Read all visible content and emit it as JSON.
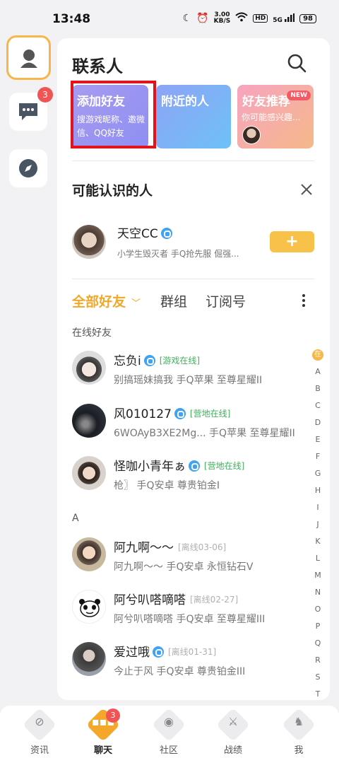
{
  "status_bar": {
    "time": "13:48",
    "net_speed_value": "3.00",
    "net_speed_unit": "KB/S",
    "hd": "HD",
    "signal": "5G",
    "battery": "98"
  },
  "rail": {
    "message_badge": "3"
  },
  "header": {
    "title": "联系人"
  },
  "action_cards": {
    "add_friend_title": "添加好友",
    "add_friend_desc": "搜游戏昵称、邀微信、QQ好友",
    "nearby_title": "附近的人",
    "recommend_title": "好友推荐",
    "recommend_badge": "NEW",
    "recommend_desc": "你可能感兴趣..."
  },
  "suggestions": {
    "title": "可能认识的人",
    "name": "天空CC",
    "desc": "小学生毁灭者 手Q抢先服 倔强...",
    "add_label": "+"
  },
  "tabs": {
    "all_friends": "全部好友",
    "groups": "群组",
    "subscriptions": "订阅号"
  },
  "groups": {
    "online": "在线好友",
    "a": "A"
  },
  "friends": [
    {
      "name": "忘负i",
      "status": "[游戏在线]",
      "desc": "别搞瑶妹搞我  手Q苹果  至尊星耀II"
    },
    {
      "name": "风010127",
      "status": "[营地在线]",
      "desc": "6WOAyB3XE2Mg...  手Q苹果  至尊星耀II"
    },
    {
      "name": "怪咖小青年ぁ",
      "status": "[营地在线]",
      "desc": "枪〗  手Q安卓  尊贵铂金I"
    },
    {
      "name": "阿九啊～～",
      "status": "[离线03-06]",
      "desc": "阿九啊～～  手Q安卓  永恒钻石V"
    },
    {
      "name": "阿兮叭嗒嘀嗒",
      "status": "[离线02-27]",
      "desc": "阿兮叭嗒嘀嗒  手Q安卓  至尊星耀III"
    },
    {
      "name": "爱过哦",
      "status": "[离线01-31]",
      "desc": "今止于风  手Q安卓  尊贵铂金III"
    }
  ],
  "alpha_index": [
    "在",
    "A",
    "B",
    "C",
    "D",
    "E",
    "F",
    "G",
    "H",
    "I",
    "J",
    "K",
    "L",
    "M",
    "N",
    "O",
    "P",
    "Q",
    "R",
    "S",
    "T"
  ],
  "bottom_nav": {
    "news": "资讯",
    "chat": "聊天",
    "community": "社区",
    "record": "战绩",
    "me": "我",
    "chat_badge": "3"
  },
  "colors": {
    "accent": "#f0a82b",
    "badge": "#f05454",
    "online": "#3fb05b",
    "highlight": "#e2141b"
  }
}
